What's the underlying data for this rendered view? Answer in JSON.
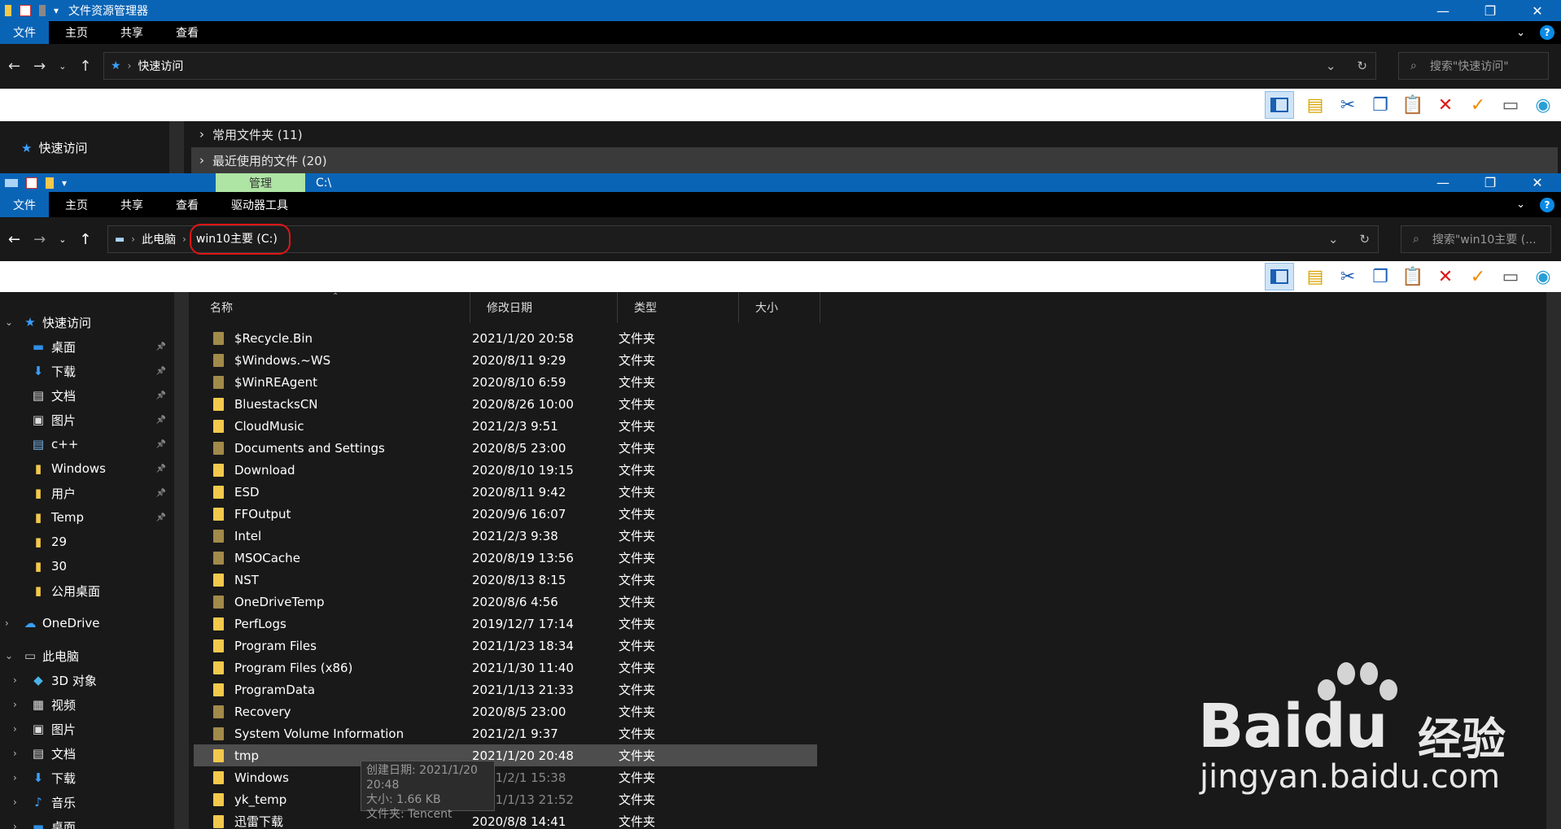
{
  "top_window": {
    "title": "文件资源管理器",
    "ribbon_tabs": [
      "文件",
      "主页",
      "共享",
      "查看"
    ],
    "address": "快速访问",
    "search_placeholder": "搜索\"快速访问\"",
    "sidebar_item": "快速访问",
    "groups": [
      "常用文件夹 (11)",
      "最近使用的文件 (20)"
    ]
  },
  "main_window": {
    "manage_tab": "管理",
    "path_title": "C:\\",
    "ribbon_tabs": [
      "文件",
      "主页",
      "共享",
      "查看",
      "驱动器工具"
    ],
    "breadcrumb": [
      "此电脑",
      "win10主要 (C:)"
    ],
    "search_placeholder": "搜索\"win10主要 (...",
    "columns": [
      "名称",
      "修改日期",
      "类型",
      "大小"
    ],
    "sidebar": [
      {
        "label": "快速访问",
        "icon": "star-icon"
      },
      {
        "label": "桌面",
        "icon": "desktop-icon"
      },
      {
        "label": "下载",
        "icon": "download-icon"
      },
      {
        "label": "文档",
        "icon": "document-icon"
      },
      {
        "label": "图片",
        "icon": "picture-icon"
      },
      {
        "label": "c++",
        "icon": "code-folder-icon"
      },
      {
        "label": "Windows",
        "icon": "folder-icon"
      },
      {
        "label": "用户",
        "icon": "folder-icon"
      },
      {
        "label": "Temp",
        "icon": "folder-icon"
      },
      {
        "label": "29",
        "icon": "folder-icon"
      },
      {
        "label": "30",
        "icon": "folder-icon"
      },
      {
        "label": "公用桌面",
        "icon": "folder-icon"
      },
      {
        "label": "OneDrive",
        "icon": "cloud-icon"
      },
      {
        "label": "此电脑",
        "icon": "computer-icon"
      },
      {
        "label": "3D 对象",
        "icon": "cube-icon"
      },
      {
        "label": "视频",
        "icon": "video-icon"
      },
      {
        "label": "图片",
        "icon": "picture-icon"
      },
      {
        "label": "文档",
        "icon": "document-icon"
      },
      {
        "label": "下载",
        "icon": "download-icon"
      },
      {
        "label": "音乐",
        "icon": "music-icon"
      },
      {
        "label": "桌面",
        "icon": "desktop-icon"
      }
    ],
    "files": [
      {
        "name": "$Recycle.Bin",
        "date": "2021/1/20 20:58",
        "type": "文件夹"
      },
      {
        "name": "$Windows.~WS",
        "date": "2020/8/11 9:29",
        "type": "文件夹"
      },
      {
        "name": "$WinREAgent",
        "date": "2020/8/10 6:59",
        "type": "文件夹"
      },
      {
        "name": "BluestacksCN",
        "date": "2020/8/26 10:00",
        "type": "文件夹"
      },
      {
        "name": "CloudMusic",
        "date": "2021/2/3 9:51",
        "type": "文件夹"
      },
      {
        "name": "Documents and Settings",
        "date": "2020/8/5 23:00",
        "type": "文件夹"
      },
      {
        "name": "Download",
        "date": "2020/8/10 19:15",
        "type": "文件夹"
      },
      {
        "name": "ESD",
        "date": "2020/8/11 9:42",
        "type": "文件夹"
      },
      {
        "name": "FFOutput",
        "date": "2020/9/6 16:07",
        "type": "文件夹"
      },
      {
        "name": "Intel",
        "date": "2021/2/3 9:38",
        "type": "文件夹"
      },
      {
        "name": "MSOCache",
        "date": "2020/8/19 13:56",
        "type": "文件夹"
      },
      {
        "name": "NST",
        "date": "2020/8/13 8:15",
        "type": "文件夹"
      },
      {
        "name": "OneDriveTemp",
        "date": "2020/8/6 4:56",
        "type": "文件夹"
      },
      {
        "name": "PerfLogs",
        "date": "2019/12/7 17:14",
        "type": "文件夹"
      },
      {
        "name": "Program Files",
        "date": "2021/1/23 18:34",
        "type": "文件夹"
      },
      {
        "name": "Program Files (x86)",
        "date": "2021/1/30 11:40",
        "type": "文件夹"
      },
      {
        "name": "ProgramData",
        "date": "2021/1/13 21:33",
        "type": "文件夹"
      },
      {
        "name": "Recovery",
        "date": "2020/8/5 23:00",
        "type": "文件夹"
      },
      {
        "name": "System Volume Information",
        "date": "2021/2/1 9:37",
        "type": "文件夹"
      },
      {
        "name": "tmp",
        "date": "2021/1/20 20:48",
        "type": "文件夹"
      },
      {
        "name": "Windows",
        "date": "2021/2/1 15:38",
        "type": "文件夹"
      },
      {
        "name": "yk_temp",
        "date": "2021/1/13 21:52",
        "type": "文件夹"
      },
      {
        "name": "迅雷下载",
        "date": "2020/8/8 14:41",
        "type": "文件夹"
      }
    ],
    "tooltip": [
      "创建日期: 2021/1/20 20:48",
      "大小: 1.66 KB",
      "文件夹: Tencent"
    ]
  },
  "watermark": {
    "brand": "Bai",
    "brand2": "du",
    "cn": "经验",
    "url": "jingyan.baidu.com"
  },
  "colors": {
    "titlebar": "#0a64b6",
    "bg": "#191919",
    "manage_tab": "#aee4a4",
    "highlight_box": "#e01515"
  }
}
